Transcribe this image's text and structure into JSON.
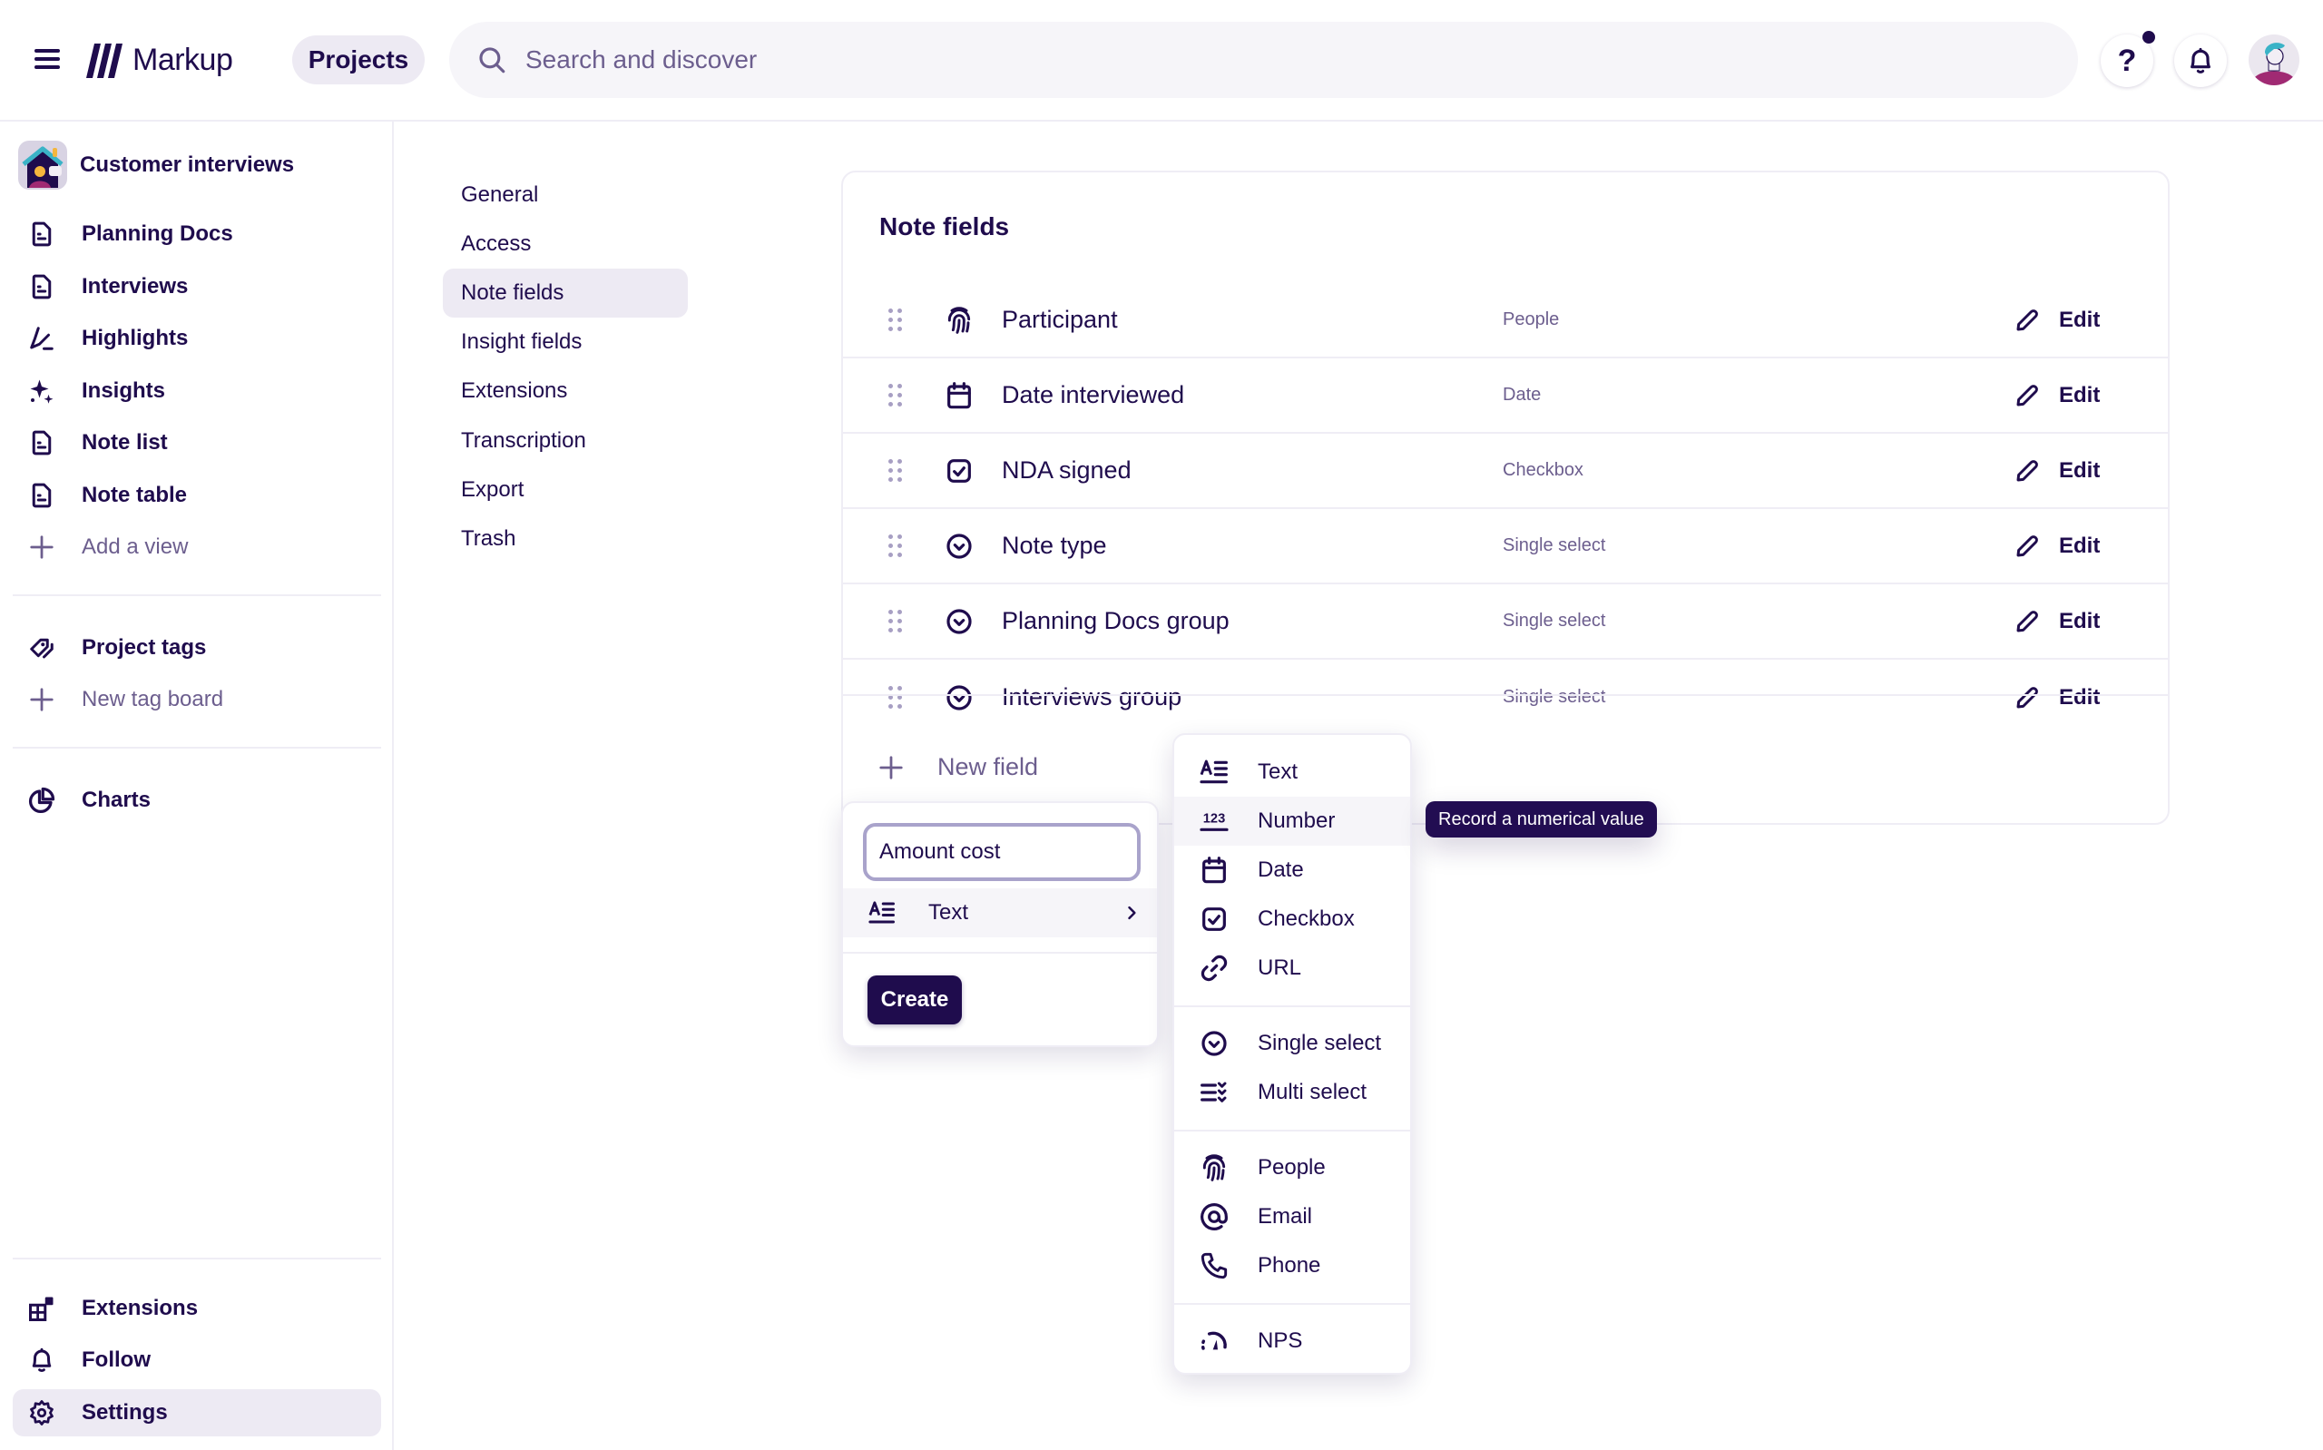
{
  "header": {
    "app_name": "Markup",
    "projects_label": "Projects",
    "search_placeholder": "Search and discover",
    "help_label": "?",
    "icons": [
      "hamburger-menu-icon",
      "markup-logo-icon",
      "search-icon",
      "help-icon",
      "bell-icon",
      "avatar"
    ]
  },
  "sidebar": {
    "project_name": "Customer interviews",
    "views": [
      {
        "label": "Planning Docs",
        "icon": "document-icon"
      },
      {
        "label": "Interviews",
        "icon": "document-icon"
      },
      {
        "label": "Highlights",
        "icon": "highlighter-icon"
      },
      {
        "label": "Insights",
        "icon": "sparkles-icon"
      },
      {
        "label": "Note list",
        "icon": "document-icon"
      },
      {
        "label": "Note table",
        "icon": "document-icon"
      },
      {
        "label": "Add a view",
        "icon": "plus-icon"
      }
    ],
    "tags": [
      {
        "label": "Project tags",
        "icon": "tag-icon"
      },
      {
        "label": "New tag board",
        "icon": "plus-icon"
      }
    ],
    "charts": {
      "label": "Charts",
      "icon": "pie-chart-icon"
    },
    "bottom": [
      {
        "label": "Extensions",
        "icon": "extensions-icon"
      },
      {
        "label": "Follow",
        "icon": "bell-icon"
      },
      {
        "label": "Settings",
        "icon": "gear-icon",
        "active": true
      }
    ]
  },
  "settings_nav": {
    "items": [
      "General",
      "Access",
      "Note fields",
      "Insight fields",
      "Extensions",
      "Transcription",
      "Export",
      "Trash"
    ],
    "active": "Note fields"
  },
  "note_fields": {
    "title": "Note fields",
    "edit_label": "Edit",
    "fields": [
      {
        "name": "Participant",
        "type": "People",
        "icon": "fingerprint-icon"
      },
      {
        "name": "Date interviewed",
        "type": "Date",
        "icon": "calendar-icon"
      },
      {
        "name": "NDA signed",
        "type": "Checkbox",
        "icon": "checkbox-icon"
      },
      {
        "name": "Note type",
        "type": "Single select",
        "icon": "single-select-icon"
      },
      {
        "name": "Planning Docs group",
        "type": "Single select",
        "icon": "single-select-icon"
      },
      {
        "name": "Interviews group",
        "type": "Single select",
        "icon": "single-select-icon"
      }
    ],
    "new_field_label": "New field"
  },
  "new_field_form": {
    "name_value": "Amount cost",
    "type_label": "Text",
    "create_label": "Create"
  },
  "type_dropdown": {
    "groups": [
      [
        {
          "label": "Text",
          "icon": "text-icon"
        },
        {
          "label": "Number",
          "icon": "number-icon",
          "hovered": true
        },
        {
          "label": "Date",
          "icon": "calendar-icon"
        },
        {
          "label": "Checkbox",
          "icon": "checkbox-icon"
        },
        {
          "label": "URL",
          "icon": "link-icon"
        }
      ],
      [
        {
          "label": "Single select",
          "icon": "single-select-icon"
        },
        {
          "label": "Multi select",
          "icon": "multi-select-icon"
        }
      ],
      [
        {
          "label": "People",
          "icon": "fingerprint-icon"
        },
        {
          "label": "Email",
          "icon": "at-icon"
        },
        {
          "label": "Phone",
          "icon": "phone-icon"
        }
      ],
      [
        {
          "label": "NPS",
          "icon": "gauge-icon"
        }
      ]
    ],
    "tooltip": "Record a numerical value"
  },
  "colors": {
    "brand": "#1f0c4d",
    "muted_text": "#6c5e8e",
    "active_bg": "#edeaf3",
    "border": "#efedf5",
    "tooltip_bg": "#220d52"
  }
}
